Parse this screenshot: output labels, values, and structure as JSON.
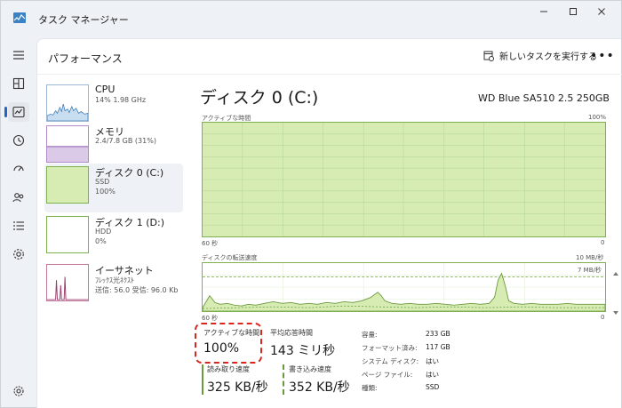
{
  "window": {
    "title": "タスク マネージャー",
    "controls": {
      "minimize": "—",
      "maximize": "☐",
      "close": "✕"
    }
  },
  "nav": {
    "items": [
      {
        "icon": "hamburger-icon"
      },
      {
        "icon": "processes-icon"
      },
      {
        "icon": "performance-icon",
        "active": true
      },
      {
        "icon": "app-history-icon"
      },
      {
        "icon": "startup-apps-icon"
      },
      {
        "icon": "users-icon"
      },
      {
        "icon": "details-icon"
      },
      {
        "icon": "services-icon"
      },
      {
        "icon": "settings-icon"
      }
    ]
  },
  "header": {
    "title": "パフォーマンス",
    "run_task": "新しいタスクを実行する",
    "more": "•••"
  },
  "perf_list": [
    {
      "name": "CPU",
      "sub1": "14%  1.98 GHz",
      "sub2": "",
      "sub3": ""
    },
    {
      "name": "メモリ",
      "sub1": "2.4/7.8 GB (31%)",
      "sub2": "",
      "sub3": ""
    },
    {
      "name": "ディスク 0 (C:)",
      "sub1": "SSD",
      "sub2": "100%",
      "sub3": "",
      "selected": true
    },
    {
      "name": "ディスク 1 (D:)",
      "sub1": "HDD",
      "sub2": "0%",
      "sub3": ""
    },
    {
      "name": "イーサネット",
      "sub1": "ﾌﾚｯｸｽ光ﾈｸｽﾄ",
      "sub2": "送信: 56.0  受信: 96.0 Kb",
      "sub3": ""
    }
  ],
  "detail": {
    "title": "ディスク 0 (C:)",
    "model": "WD Blue SA510 2.5 250GB",
    "active_time_graph": {
      "label": "アクティブな時間",
      "max": "100%",
      "time_label": "60 秒",
      "min": "0"
    },
    "transfer_graph": {
      "label": "ディスクの転送速度",
      "max": "10 MB/秒",
      "line_label": "7 MB/秒",
      "time_label": "60 秒",
      "min": "0"
    }
  },
  "stats": {
    "active_time": {
      "label": "アクティブな時間",
      "value": "100%"
    },
    "avg_response": {
      "label": "平均応答時間",
      "value": "143 ミリ秒"
    },
    "read_speed": {
      "label": "読み取り速度",
      "value": "325 KB/秒"
    },
    "write_speed": {
      "label": "書き込み速度",
      "value": "352 KB/秒"
    }
  },
  "info": [
    {
      "label": "容量:",
      "value": "233 GB"
    },
    {
      "label": "フォーマット済み:",
      "value": "117 GB"
    },
    {
      "label": "システム ディスク:",
      "value": "はい"
    },
    {
      "label": "ページ ファイル:",
      "value": "はい"
    },
    {
      "label": "種類:",
      "value": "SSD"
    }
  ],
  "colors": {
    "accent": "#2563c6",
    "disk_fill": "#d6ecb3",
    "disk_border": "#7fb04f",
    "highlight": "#d7261e"
  }
}
